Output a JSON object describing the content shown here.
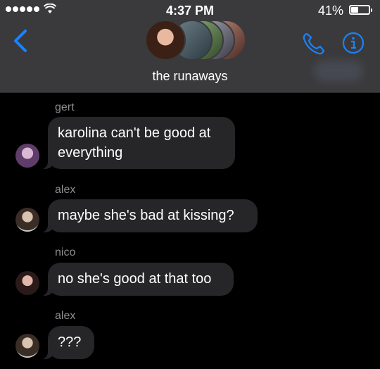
{
  "status_bar": {
    "time": "4:37 PM",
    "battery_percent": "41%",
    "battery_level": 0.41,
    "signal_bars": 5
  },
  "header": {
    "thread_name": "the runaways",
    "back_icon": "chevron-left-icon",
    "call_icon": "phone-icon",
    "info_icon": "info-icon",
    "accent_color": "#1a82fb"
  },
  "messages": [
    {
      "sender": "gert",
      "text_lines": [
        "karolina can't be good at",
        "everything"
      ]
    },
    {
      "sender": "alex",
      "text": "maybe she's bad at kissing?"
    },
    {
      "sender": "nico",
      "text": "no she's good at that too"
    },
    {
      "sender": "alex",
      "text": "???"
    }
  ]
}
